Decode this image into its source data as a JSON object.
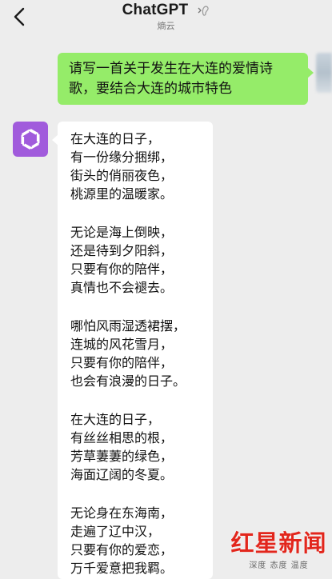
{
  "header": {
    "title": "ChatGPT",
    "subtitle": "熵云"
  },
  "user_message": {
    "text": "请写一首关于发生在大连的爱情诗歌，要结合大连的城市特色"
  },
  "bot_message": {
    "stanzas": [
      [
        "在大连的日子，",
        "有一份缘分捆绑，",
        "街头的俏丽夜色，",
        "桃源里的温暖家。"
      ],
      [
        "无论是海上倒映，",
        "还是待到夕阳斜，",
        "只要有你的陪伴，",
        "真情也不会褪去。"
      ],
      [
        "哪怕风雨湿透裙摆，",
        "连城的风花雪月，",
        "只要有你的陪伴，",
        "也会有浪漫的日子。"
      ],
      [
        "在大连的日子，",
        "有丝丝相思的根，",
        "芳草萋萋的绿色，",
        "海面辽阔的冬夏。"
      ],
      [
        "无论身在东海南，",
        "走遍了辽中汉，",
        "只要有你的爱恋，",
        "万千爱意把我羁。"
      ]
    ]
  },
  "watermark": {
    "main": "红星新闻",
    "sub": "深度 态度 温度"
  },
  "colors": {
    "background": "#ededed",
    "user_bubble": "#95ec69",
    "bot_bubble": "#ffffff",
    "bot_avatar": "#a15bdc",
    "watermark_red": "#e2261c"
  },
  "icons": {
    "back": "chevron-left-icon",
    "ear": "ear-icon",
    "bot_logo": "openai-logo-icon"
  }
}
